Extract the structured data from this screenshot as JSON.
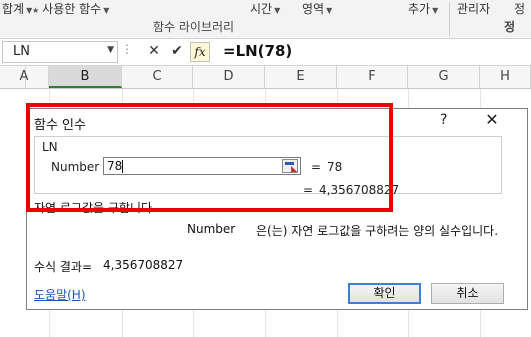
{
  "ribbon": {
    "autosum": "합계",
    "recent": "사용한 함수",
    "time": "시간",
    "area": "영역",
    "add": "추가",
    "manager": "관리자",
    "define": "정",
    "group_label": "함수 라이브러리"
  },
  "formula_bar": {
    "name_box": "LN",
    "formula": "=LN(78)"
  },
  "columns": [
    "A",
    "B",
    "C",
    "D",
    "E",
    "F",
    "G",
    "H"
  ],
  "dialog": {
    "title": "함수 인수",
    "help_glyph": "?",
    "close_glyph": "✕",
    "function_name": "LN",
    "arg_label": "Number",
    "arg_value": "78",
    "arg_result": "78",
    "eq": "=",
    "result_value": "4,356708827",
    "function_description": "자연 로그값을 구합니다.",
    "arg_desc_name": "Number",
    "arg_desc_text": "은(는) 자연 로그값을 구하려는 양의 실수입니다.",
    "formula_result_label": "수식 결과=",
    "formula_result_value": "4,356708827",
    "help_link": "도움말(H)",
    "ok_label": "확인",
    "cancel_label": "취소"
  },
  "colors": {
    "highlight": "#ee0000",
    "primary_button_border": "#3c7fd6",
    "link": "#1a55c0"
  }
}
